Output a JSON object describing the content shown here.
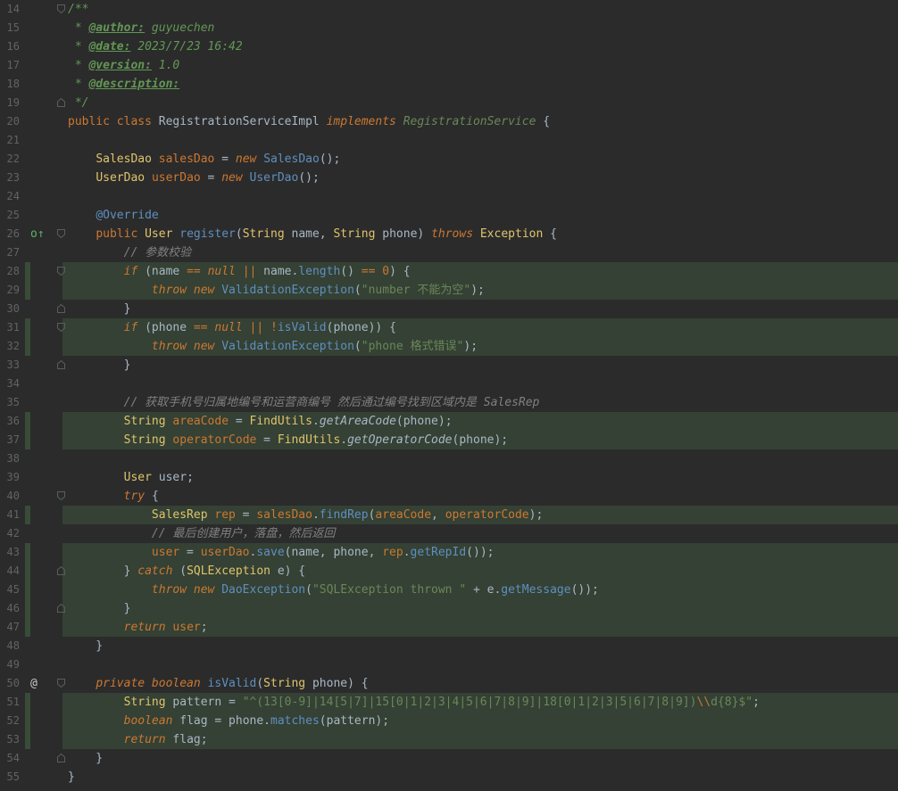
{
  "editor": {
    "lines": [
      {
        "n": "14",
        "hl": false,
        "fold": "open",
        "icon": "",
        "html": [
          [
            "doc",
            "/**"
          ]
        ]
      },
      {
        "n": "15",
        "hl": false,
        "fold": "",
        "icon": "",
        "html": [
          [
            "doc",
            " * "
          ],
          [
            "tag",
            "@author:"
          ],
          [
            "doc",
            " guyuechen"
          ]
        ]
      },
      {
        "n": "16",
        "hl": false,
        "fold": "",
        "icon": "",
        "html": [
          [
            "doc",
            " * "
          ],
          [
            "tag",
            "@date:"
          ],
          [
            "doc",
            " 2023/7/23 16:42"
          ]
        ]
      },
      {
        "n": "17",
        "hl": false,
        "fold": "",
        "icon": "",
        "html": [
          [
            "doc",
            " * "
          ],
          [
            "tag",
            "@version:"
          ],
          [
            "doc",
            " 1.0"
          ]
        ]
      },
      {
        "n": "18",
        "hl": false,
        "fold": "",
        "icon": "",
        "html": [
          [
            "doc",
            " * "
          ],
          [
            "tag",
            "@description:"
          ]
        ]
      },
      {
        "n": "19",
        "hl": false,
        "fold": "close",
        "icon": "",
        "html": [
          [
            "doc",
            " */"
          ]
        ]
      },
      {
        "n": "20",
        "hl": false,
        "fold": "",
        "icon": "",
        "html": [
          [
            "k",
            "public class "
          ],
          [
            "gray",
            "RegistrationServiceImpl "
          ],
          [
            "impl",
            "implements "
          ],
          [
            "ifc",
            "RegistrationService"
          ],
          [
            "gray",
            " {"
          ]
        ]
      },
      {
        "n": "21",
        "hl": false,
        "fold": "",
        "icon": "",
        "html": []
      },
      {
        "n": "22",
        "hl": false,
        "fold": "",
        "icon": "",
        "html": [
          [
            "gray",
            "    "
          ],
          [
            "amber",
            "SalesDao "
          ],
          [
            "orange",
            "salesDao"
          ],
          [
            "gray",
            " = "
          ],
          [
            "ki",
            "new "
          ],
          [
            "cyan",
            "SalesDao"
          ],
          [
            "gray",
            "();"
          ]
        ]
      },
      {
        "n": "23",
        "hl": false,
        "fold": "",
        "icon": "",
        "html": [
          [
            "gray",
            "    "
          ],
          [
            "amber",
            "UserDao "
          ],
          [
            "orange",
            "userDao"
          ],
          [
            "gray",
            " = "
          ],
          [
            "ki",
            "new "
          ],
          [
            "cyan",
            "UserDao"
          ],
          [
            "gray",
            "();"
          ]
        ]
      },
      {
        "n": "24",
        "hl": false,
        "fold": "",
        "icon": "",
        "html": []
      },
      {
        "n": "25",
        "hl": false,
        "fold": "",
        "icon": "",
        "html": [
          [
            "gray",
            "    "
          ],
          [
            "cyan",
            "@Override"
          ]
        ]
      },
      {
        "n": "26",
        "hl": false,
        "fold": "open",
        "icon": "o↑",
        "html": [
          [
            "gray",
            "    "
          ],
          [
            "k",
            "public "
          ],
          [
            "amber",
            "User "
          ],
          [
            "cyan",
            "register"
          ],
          [
            "gray",
            "("
          ],
          [
            "amber",
            "String "
          ],
          [
            "gray",
            "name, "
          ],
          [
            "amber",
            "String "
          ],
          [
            "gray",
            "phone) "
          ],
          [
            "ki",
            "throws "
          ],
          [
            "amber",
            "Exception"
          ],
          [
            "gray",
            " {"
          ]
        ]
      },
      {
        "n": "27",
        "hl": false,
        "fold": "",
        "icon": "",
        "html": [
          [
            "gray",
            "        "
          ],
          [
            "cmt",
            "// 参数校验"
          ]
        ]
      },
      {
        "n": "28",
        "hl": true,
        "fold": "open",
        "icon": "",
        "html": [
          [
            "gray",
            "        "
          ],
          [
            "ki",
            "if "
          ],
          [
            "gray",
            "(name "
          ],
          [
            "orange",
            "=="
          ],
          [
            "gray",
            " "
          ],
          [
            "ki",
            "null"
          ],
          [
            "gray",
            " "
          ],
          [
            "orange",
            "||"
          ],
          [
            "gray",
            " name."
          ],
          [
            "cyan",
            "length"
          ],
          [
            "gray",
            "() "
          ],
          [
            "orange",
            "=="
          ],
          [
            "gray",
            " "
          ],
          [
            "orange",
            "0"
          ],
          [
            "gray",
            ") {"
          ]
        ]
      },
      {
        "n": "29",
        "hl": true,
        "fold": "",
        "icon": "",
        "html": [
          [
            "gray",
            "            "
          ],
          [
            "ki",
            "throw new "
          ],
          [
            "cyan",
            "ValidationException"
          ],
          [
            "gray",
            "("
          ],
          [
            "str",
            "\"number 不能为空\""
          ],
          [
            "gray",
            ");"
          ]
        ]
      },
      {
        "n": "30",
        "hl": false,
        "fold": "close",
        "icon": "",
        "html": [
          [
            "gray",
            "        }"
          ]
        ]
      },
      {
        "n": "31",
        "hl": true,
        "fold": "open",
        "icon": "",
        "html": [
          [
            "gray",
            "        "
          ],
          [
            "ki",
            "if "
          ],
          [
            "gray",
            "(phone "
          ],
          [
            "orange",
            "=="
          ],
          [
            "gray",
            " "
          ],
          [
            "ki",
            "null"
          ],
          [
            "gray",
            " "
          ],
          [
            "orange",
            "||"
          ],
          [
            "gray",
            " "
          ],
          [
            "orange",
            "!"
          ],
          [
            "cyan",
            "isValid"
          ],
          [
            "gray",
            "(phone)) {"
          ]
        ]
      },
      {
        "n": "32",
        "hl": true,
        "fold": "",
        "icon": "",
        "html": [
          [
            "gray",
            "            "
          ],
          [
            "ki",
            "throw new "
          ],
          [
            "cyan",
            "ValidationException"
          ],
          [
            "gray",
            "("
          ],
          [
            "str",
            "\"phone 格式错误\""
          ],
          [
            "gray",
            ");"
          ]
        ]
      },
      {
        "n": "33",
        "hl": false,
        "fold": "close",
        "icon": "",
        "html": [
          [
            "gray",
            "        }"
          ]
        ]
      },
      {
        "n": "34",
        "hl": false,
        "fold": "",
        "icon": "",
        "html": []
      },
      {
        "n": "35",
        "hl": false,
        "fold": "",
        "icon": "",
        "html": [
          [
            "gray",
            "        "
          ],
          [
            "cmt",
            "// 获取手机号归属地编号和运营商编号 然后通过编号找到区域内是 SalesRep"
          ]
        ]
      },
      {
        "n": "36",
        "hl": true,
        "fold": "",
        "icon": "",
        "html": [
          [
            "gray",
            "        "
          ],
          [
            "amber",
            "String "
          ],
          [
            "orange",
            "areaCode"
          ],
          [
            "gray",
            " = "
          ],
          [
            "amber",
            "FindUtils"
          ],
          [
            "gray",
            "."
          ],
          [
            "static",
            "getAreaCode"
          ],
          [
            "gray",
            "(phone);"
          ]
        ]
      },
      {
        "n": "37",
        "hl": true,
        "fold": "",
        "icon": "",
        "html": [
          [
            "gray",
            "        "
          ],
          [
            "amber",
            "String "
          ],
          [
            "orange",
            "operatorCode"
          ],
          [
            "gray",
            " = "
          ],
          [
            "amber",
            "FindUtils"
          ],
          [
            "gray",
            "."
          ],
          [
            "static",
            "getOperatorCode"
          ],
          [
            "gray",
            "(phone);"
          ]
        ]
      },
      {
        "n": "38",
        "hl": false,
        "fold": "",
        "icon": "",
        "html": []
      },
      {
        "n": "39",
        "hl": false,
        "fold": "",
        "icon": "",
        "html": [
          [
            "gray",
            "        "
          ],
          [
            "amber",
            "User "
          ],
          [
            "gray",
            "user;"
          ]
        ]
      },
      {
        "n": "40",
        "hl": false,
        "fold": "open",
        "icon": "",
        "html": [
          [
            "gray",
            "        "
          ],
          [
            "ki",
            "try "
          ],
          [
            "gray",
            "{"
          ]
        ]
      },
      {
        "n": "41",
        "hl": true,
        "fold": "",
        "icon": "",
        "html": [
          [
            "gray",
            "            "
          ],
          [
            "amber",
            "SalesRep "
          ],
          [
            "orange",
            "rep"
          ],
          [
            "gray",
            " = "
          ],
          [
            "orange",
            "salesDao"
          ],
          [
            "gray",
            "."
          ],
          [
            "cyan",
            "findRep"
          ],
          [
            "gray",
            "("
          ],
          [
            "orange",
            "areaCode"
          ],
          [
            "gray",
            ", "
          ],
          [
            "orange",
            "operatorCode"
          ],
          [
            "gray",
            ");"
          ]
        ]
      },
      {
        "n": "42",
        "hl": false,
        "fold": "",
        "icon": "",
        "html": [
          [
            "gray",
            "            "
          ],
          [
            "cmt",
            "// 最后创建用户，落盘，然后返回"
          ]
        ]
      },
      {
        "n": "43",
        "hl": true,
        "fold": "",
        "icon": "",
        "html": [
          [
            "gray",
            "            "
          ],
          [
            "orange",
            "user"
          ],
          [
            "gray",
            " = "
          ],
          [
            "orange",
            "userDao"
          ],
          [
            "gray",
            "."
          ],
          [
            "cyan",
            "save"
          ],
          [
            "gray",
            "(name, phone, "
          ],
          [
            "orange",
            "rep"
          ],
          [
            "gray",
            "."
          ],
          [
            "cyan",
            "getRepId"
          ],
          [
            "gray",
            "());"
          ]
        ]
      },
      {
        "n": "44",
        "hl": true,
        "fold": "close",
        "icon": "",
        "html": [
          [
            "gray",
            "        } "
          ],
          [
            "ki",
            "catch "
          ],
          [
            "gray",
            "("
          ],
          [
            "amber",
            "SQLException "
          ],
          [
            "gray",
            "e) {"
          ]
        ]
      },
      {
        "n": "45",
        "hl": true,
        "fold": "",
        "icon": "",
        "html": [
          [
            "gray",
            "            "
          ],
          [
            "ki",
            "throw new "
          ],
          [
            "cyan",
            "DaoException"
          ],
          [
            "gray",
            "("
          ],
          [
            "str",
            "\"SQLException thrown \""
          ],
          [
            "gray",
            " + e."
          ],
          [
            "cyan",
            "getMessage"
          ],
          [
            "gray",
            "());"
          ]
        ]
      },
      {
        "n": "46",
        "hl": true,
        "fold": "close",
        "icon": "",
        "html": [
          [
            "gray",
            "        }"
          ]
        ]
      },
      {
        "n": "47",
        "hl": true,
        "fold": "",
        "icon": "",
        "html": [
          [
            "gray",
            "        "
          ],
          [
            "ki",
            "return "
          ],
          [
            "orange",
            "user"
          ],
          [
            "gray",
            ";"
          ]
        ]
      },
      {
        "n": "48",
        "hl": false,
        "fold": "",
        "icon": "",
        "html": [
          [
            "gray",
            "    }"
          ]
        ]
      },
      {
        "n": "49",
        "hl": false,
        "fold": "",
        "icon": "",
        "html": []
      },
      {
        "n": "50",
        "hl": false,
        "fold": "open",
        "icon": "@",
        "html": [
          [
            "gray",
            "    "
          ],
          [
            "ki",
            "private boolean "
          ],
          [
            "cyan",
            "isValid"
          ],
          [
            "gray",
            "("
          ],
          [
            "amber",
            "String "
          ],
          [
            "gray",
            "phone) {"
          ]
        ]
      },
      {
        "n": "51",
        "hl": true,
        "fold": "",
        "icon": "",
        "html": [
          [
            "gray",
            "        "
          ],
          [
            "amber",
            "String "
          ],
          [
            "gray",
            "pattern = "
          ],
          [
            "str",
            "\"^(13[0-9]|14[5|7]|15[0|1|2|3|4|5|6|7|8|9]|18[0|1|2|3|5|6|7|8|9])"
          ],
          [
            "esc",
            "\\\\"
          ],
          [
            "str",
            "d{8}$\""
          ],
          [
            "gray",
            ";"
          ]
        ]
      },
      {
        "n": "52",
        "hl": true,
        "fold": "",
        "icon": "",
        "html": [
          [
            "gray",
            "        "
          ],
          [
            "ki",
            "boolean "
          ],
          [
            "gray",
            "flag = phone."
          ],
          [
            "cyan",
            "matches"
          ],
          [
            "gray",
            "(pattern);"
          ]
        ]
      },
      {
        "n": "53",
        "hl": true,
        "fold": "",
        "icon": "",
        "html": [
          [
            "gray",
            "        "
          ],
          [
            "ki",
            "return "
          ],
          [
            "gray",
            "flag;"
          ]
        ]
      },
      {
        "n": "54",
        "hl": false,
        "fold": "close",
        "icon": "",
        "html": [
          [
            "gray",
            "    }"
          ]
        ]
      },
      {
        "n": "55",
        "hl": false,
        "fold": "",
        "icon": "",
        "html": [
          [
            "gray",
            "}"
          ]
        ]
      }
    ]
  }
}
